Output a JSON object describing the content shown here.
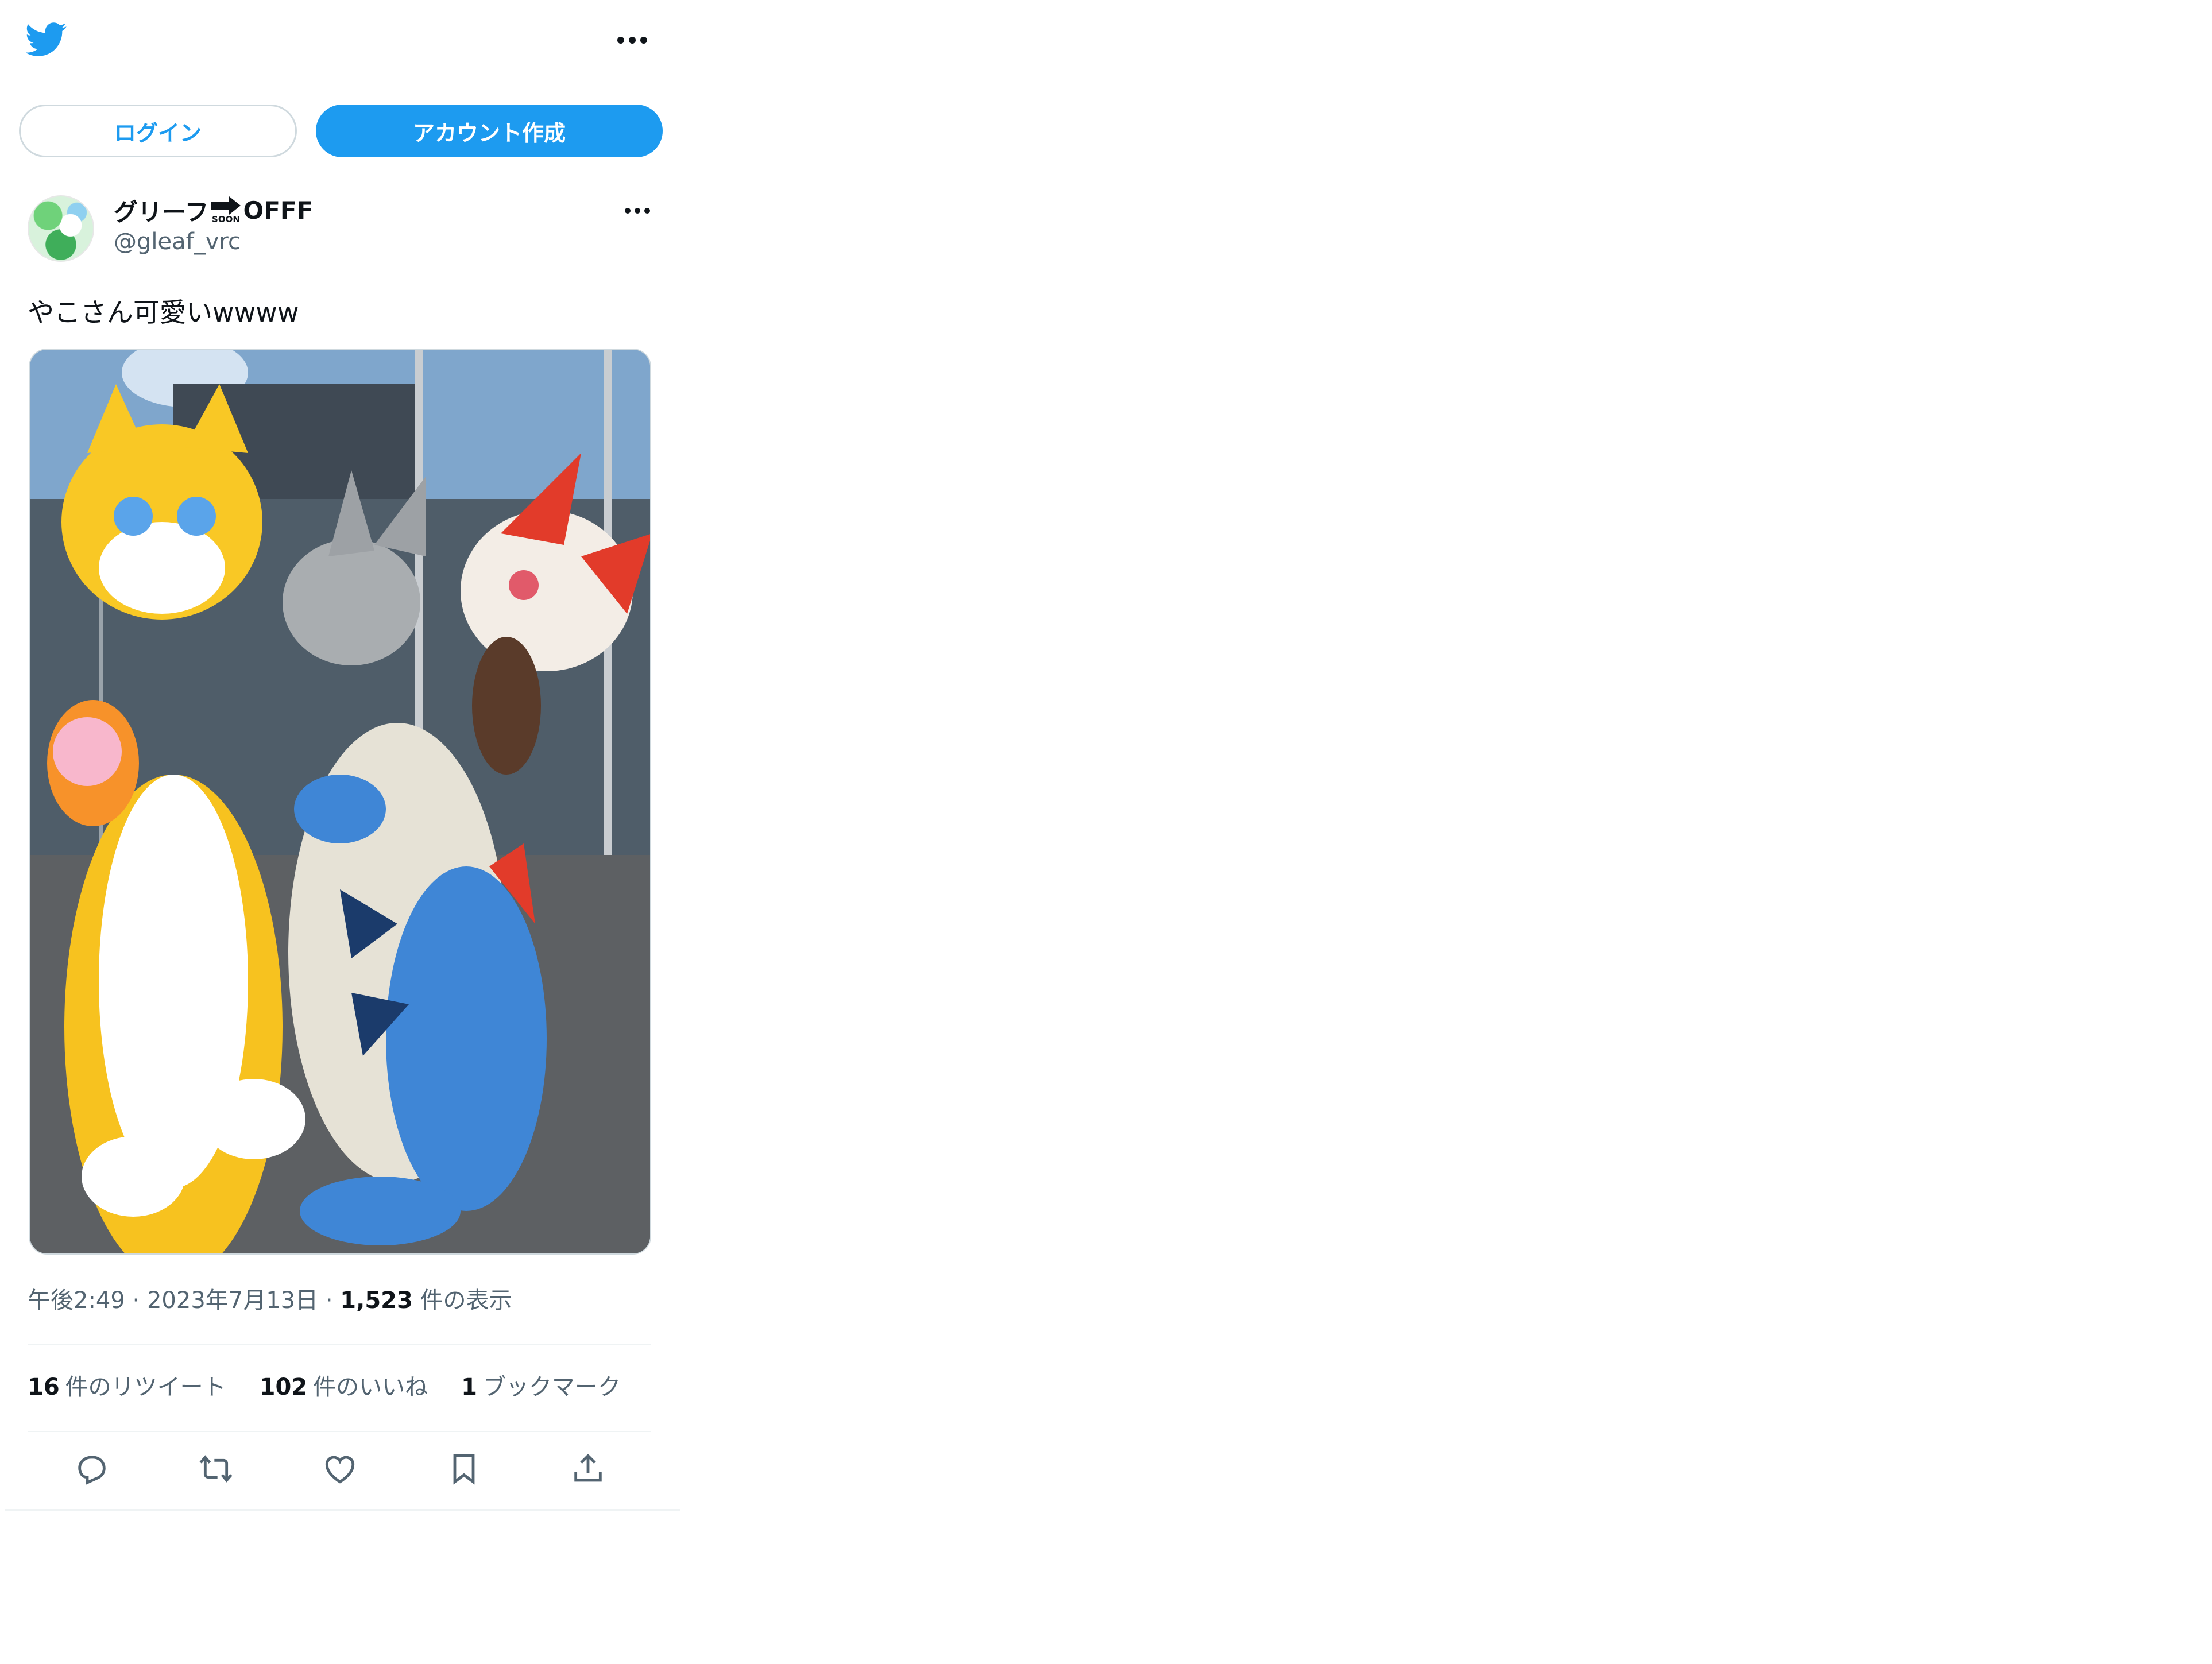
{
  "header": {
    "logo_icon": "twitter-bird-icon",
    "more_icon": "more-horizontal-icon"
  },
  "auth": {
    "login_label": "ログイン",
    "signup_label": "アカウント作成"
  },
  "tweet": {
    "author": {
      "name_prefix": "グリーフ",
      "name_emoji": "soon-arrow-icon",
      "name_emoji_text": "SOON",
      "name_suffix": "OFFF",
      "handle": "@gleaf_vrc",
      "avatar_icon": "avatar"
    },
    "text": "やこさん可愛いwwww",
    "media_description_icon": "photo",
    "time": "午後2:49",
    "date": "2023年7月13日",
    "views_count": "1,523",
    "views_label": "件の表示",
    "dot_separator": "·",
    "retweets_count": "16",
    "retweets_label": "件のリツイート",
    "likes_count": "102",
    "likes_label": "件のいいね",
    "bookmarks_count": "1",
    "bookmarks_label": "ブックマーク"
  },
  "actions": [
    "reply-icon",
    "retweet-icon",
    "like-icon",
    "bookmark-icon",
    "share-icon"
  ],
  "colors": {
    "accent": "#1d9bf0",
    "text_primary": "#0f1419",
    "text_secondary": "#536471",
    "border": "#cfd9de"
  }
}
